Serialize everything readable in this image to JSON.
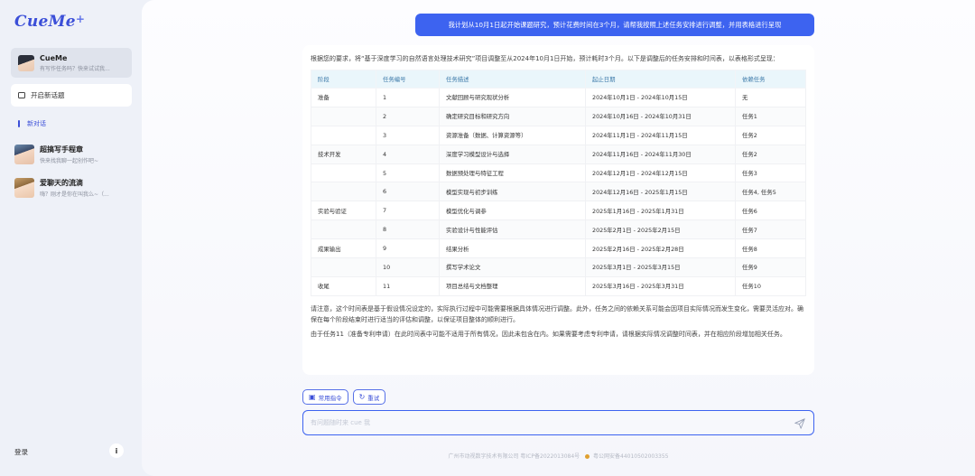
{
  "sidebar": {
    "logo": "CueMe",
    "logo_plus": "+",
    "agent": {
      "name": "CueMe",
      "subtitle": "有写作任务吗？快来试试我..."
    },
    "new_chat_label": "开启新话题",
    "section_label": "新对话",
    "conversations": [
      {
        "name": "超搞写手程章",
        "subtitle": "快来找我聊一起创作吧~"
      },
      {
        "name": "爱聊天的流滴",
        "subtitle": "嗨？刚才是你在叫我么~（..."
      }
    ],
    "login_label": "登录",
    "info_label": "i"
  },
  "chat": {
    "user_message": "我计划从10月1日起开始课题研究，预计花费时间在3个月，请帮我按照上述任务安排进行调整，并用表格进行呈现",
    "reply_intro": "根据您的要求，将“基于深度学习的自然语言处理技术研究”项目调整至从2024年10月1日开始，预计耗时3个月。以下是调整后的任务安排和时间表，以表格形式呈现：",
    "table": {
      "headers": [
        "阶段",
        "任务编号",
        "任务描述",
        "起止日期",
        "依赖任务"
      ],
      "rows": [
        [
          "准备",
          "1",
          "文献回顾与研究现状分析",
          "2024年10月1日 - 2024年10月15日",
          "无"
        ],
        [
          "",
          "2",
          "确定研究目标和研究方向",
          "2024年10月16日 - 2024年10月31日",
          "任务1"
        ],
        [
          "",
          "3",
          "资源准备（数据、计算资源等）",
          "2024年11月1日 - 2024年11月15日",
          "任务2"
        ],
        [
          "技术开发",
          "4",
          "深度学习模型设计与选择",
          "2024年11月16日 - 2024年11月30日",
          "任务2"
        ],
        [
          "",
          "5",
          "数据预处理与特征工程",
          "2024年12月1日 - 2024年12月15日",
          "任务3"
        ],
        [
          "",
          "6",
          "模型实现与初步训练",
          "2024年12月16日 - 2025年1月15日",
          "任务4, 任务5"
        ],
        [
          "实验与验证",
          "7",
          "模型优化与调参",
          "2025年1月16日 - 2025年1月31日",
          "任务6"
        ],
        [
          "",
          "8",
          "实验设计与性能评估",
          "2025年2月1日 - 2025年2月15日",
          "任务7"
        ],
        [
          "成果输出",
          "9",
          "结果分析",
          "2025年2月16日 - 2025年2月28日",
          "任务8"
        ],
        [
          "",
          "10",
          "撰写学术论文",
          "2025年3月1日 - 2025年3月15日",
          "任务9"
        ],
        [
          "收尾",
          "11",
          "项目总结与文档整理",
          "2025年3月16日 - 2025年3月31日",
          "任务10"
        ]
      ]
    },
    "note1": "请注意，这个时间表是基于假设情况设定的，实际执行过程中可能需要根据具体情况进行调整。此外，任务之间的依赖关系可能会因项目实际情况而发生变化，需要灵活应对。确保在每个阶段结束时进行适当的评估和调整，以保证项目整体的顺利进行。",
    "note2": "由于任务11（准备专利申请）在此时间表中可能不适用于所有情况，因此未包含在内。如果需要考虑专利申请，请根据实际情况调整时间表，并在相应阶段增加相关任务。"
  },
  "actions": {
    "common_commands": "常用指令",
    "retry": "重试"
  },
  "input": {
    "placeholder": "有问题随时来 cue 我"
  },
  "footer": {
    "icp": "广州市动视数字技术有限公司 粤ICP备2022013084号",
    "police": "粤公网安备44010502003355"
  }
}
